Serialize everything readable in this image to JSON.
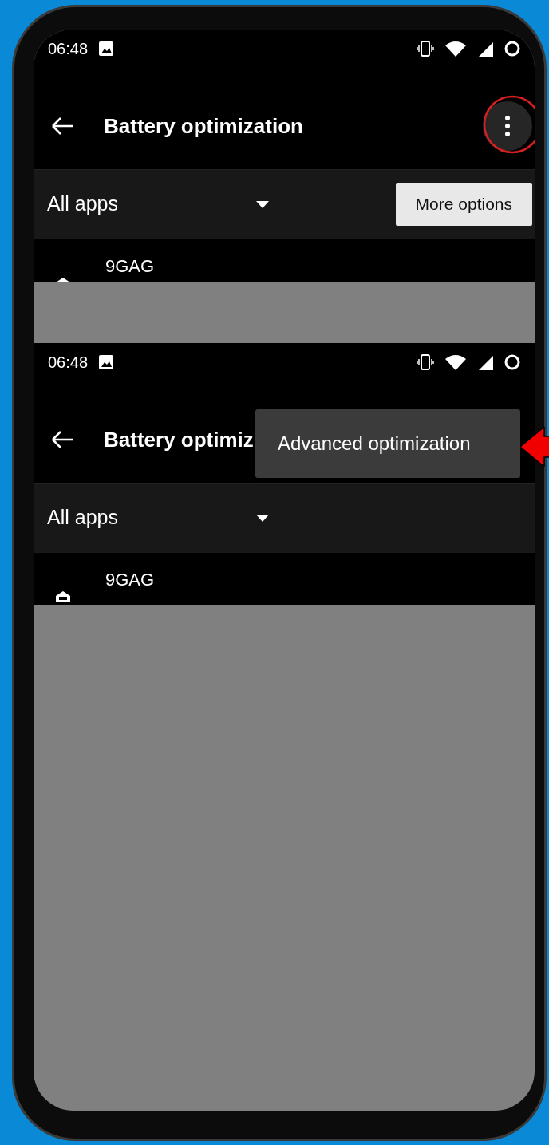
{
  "screens": [
    {
      "status_bar": {
        "time": "06:48"
      },
      "app_bar": {
        "title": "Battery optimization",
        "menu_circled": true
      },
      "filter": {
        "value": "All apps",
        "button": "More options"
      },
      "apps": [
        {
          "name": "9GAG"
        }
      ]
    },
    {
      "status_bar": {
        "time": "06:48"
      },
      "app_bar": {
        "title": "Battery optimiz"
      },
      "filter": {
        "value": "All apps"
      },
      "apps": [
        {
          "name": "9GAG"
        }
      ],
      "menu": {
        "items": [
          {
            "label": "Advanced optimization",
            "pointed": true
          }
        ]
      }
    }
  ]
}
